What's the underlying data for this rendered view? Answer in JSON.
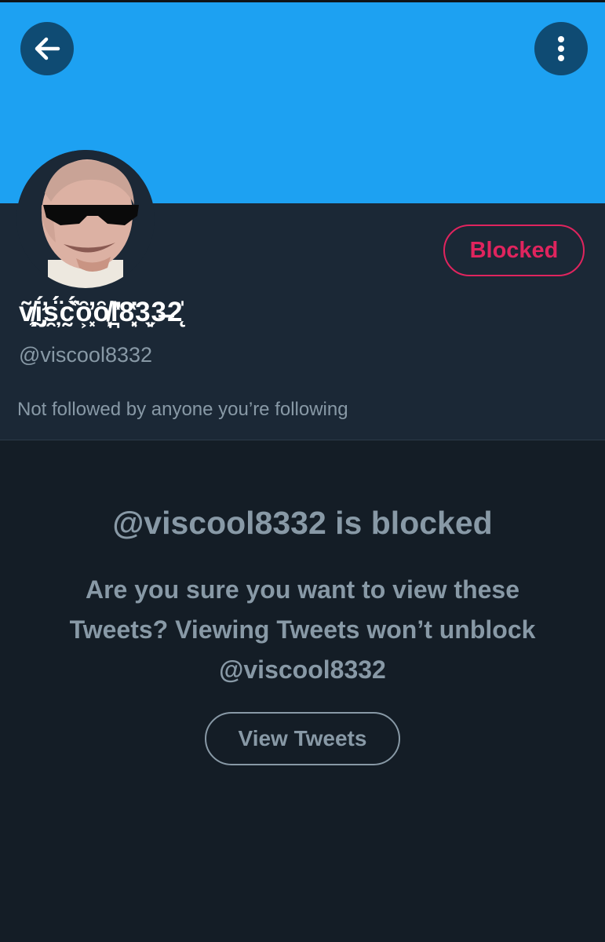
{
  "header": {
    "back_icon": "arrow-left-icon",
    "more_icon": "more-vertical-icon",
    "banner_color": "#1da1f2"
  },
  "profile": {
    "display_name": "ṽ̸̼̗͉ḭ̡̛́s̯̦̈́́c̰̈́͑̏ȏ͕͓̓ȏ̸͕͔l̪̔̓8̘͓̔3͈̬3̶2̨̍",
    "handle": "@viscool8332",
    "followers_note": "Not followed by anyone you’re following",
    "blocked_label": "Blocked",
    "blocked_color": "#e0245e"
  },
  "blocked_notice": {
    "title": "@viscool8332 is blocked",
    "message": "Are you sure you want to view these Tweets? Viewing Tweets won’t unblock @viscool8332",
    "view_button": "View Tweets"
  },
  "colors": {
    "background": "#141d26",
    "header_background": "#1b2836",
    "secondary_text": "#8899a6"
  }
}
